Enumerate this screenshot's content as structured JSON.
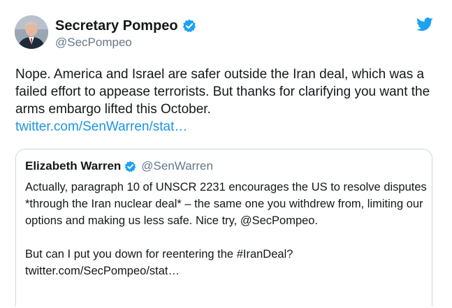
{
  "tweet": {
    "author": {
      "display_name": "Secretary Pompeo",
      "handle": "@SecPompeo"
    },
    "text": "Nope. America and Israel are safer outside the Iran deal, which was a failed effort to appease terrorists. But thanks for clarifying you want the arms embargo lifted this October.",
    "link": "twitter.com/SenWarren/stat…",
    "accent_color": "#1da1f2",
    "link_color": "#1b95e0"
  },
  "quoted_tweet": {
    "author": {
      "display_name": "Elizabeth Warren",
      "handle": "@SenWarren"
    },
    "paragraph_1": "Actually, paragraph 10 of UNSCR 2231 encourages the US to resolve disputes *through the Iran nuclear deal* – the same one you withdrew from, limiting our options and making us less safe. Nice try, @SecPompeo.",
    "paragraph_2": "But can I put you down for reentering the #IranDeal?",
    "link": "twitter.com/SecPompeo/stat…"
  },
  "icons": {
    "verified": "verified-badge-icon",
    "brand": "twitter-bird-icon"
  }
}
